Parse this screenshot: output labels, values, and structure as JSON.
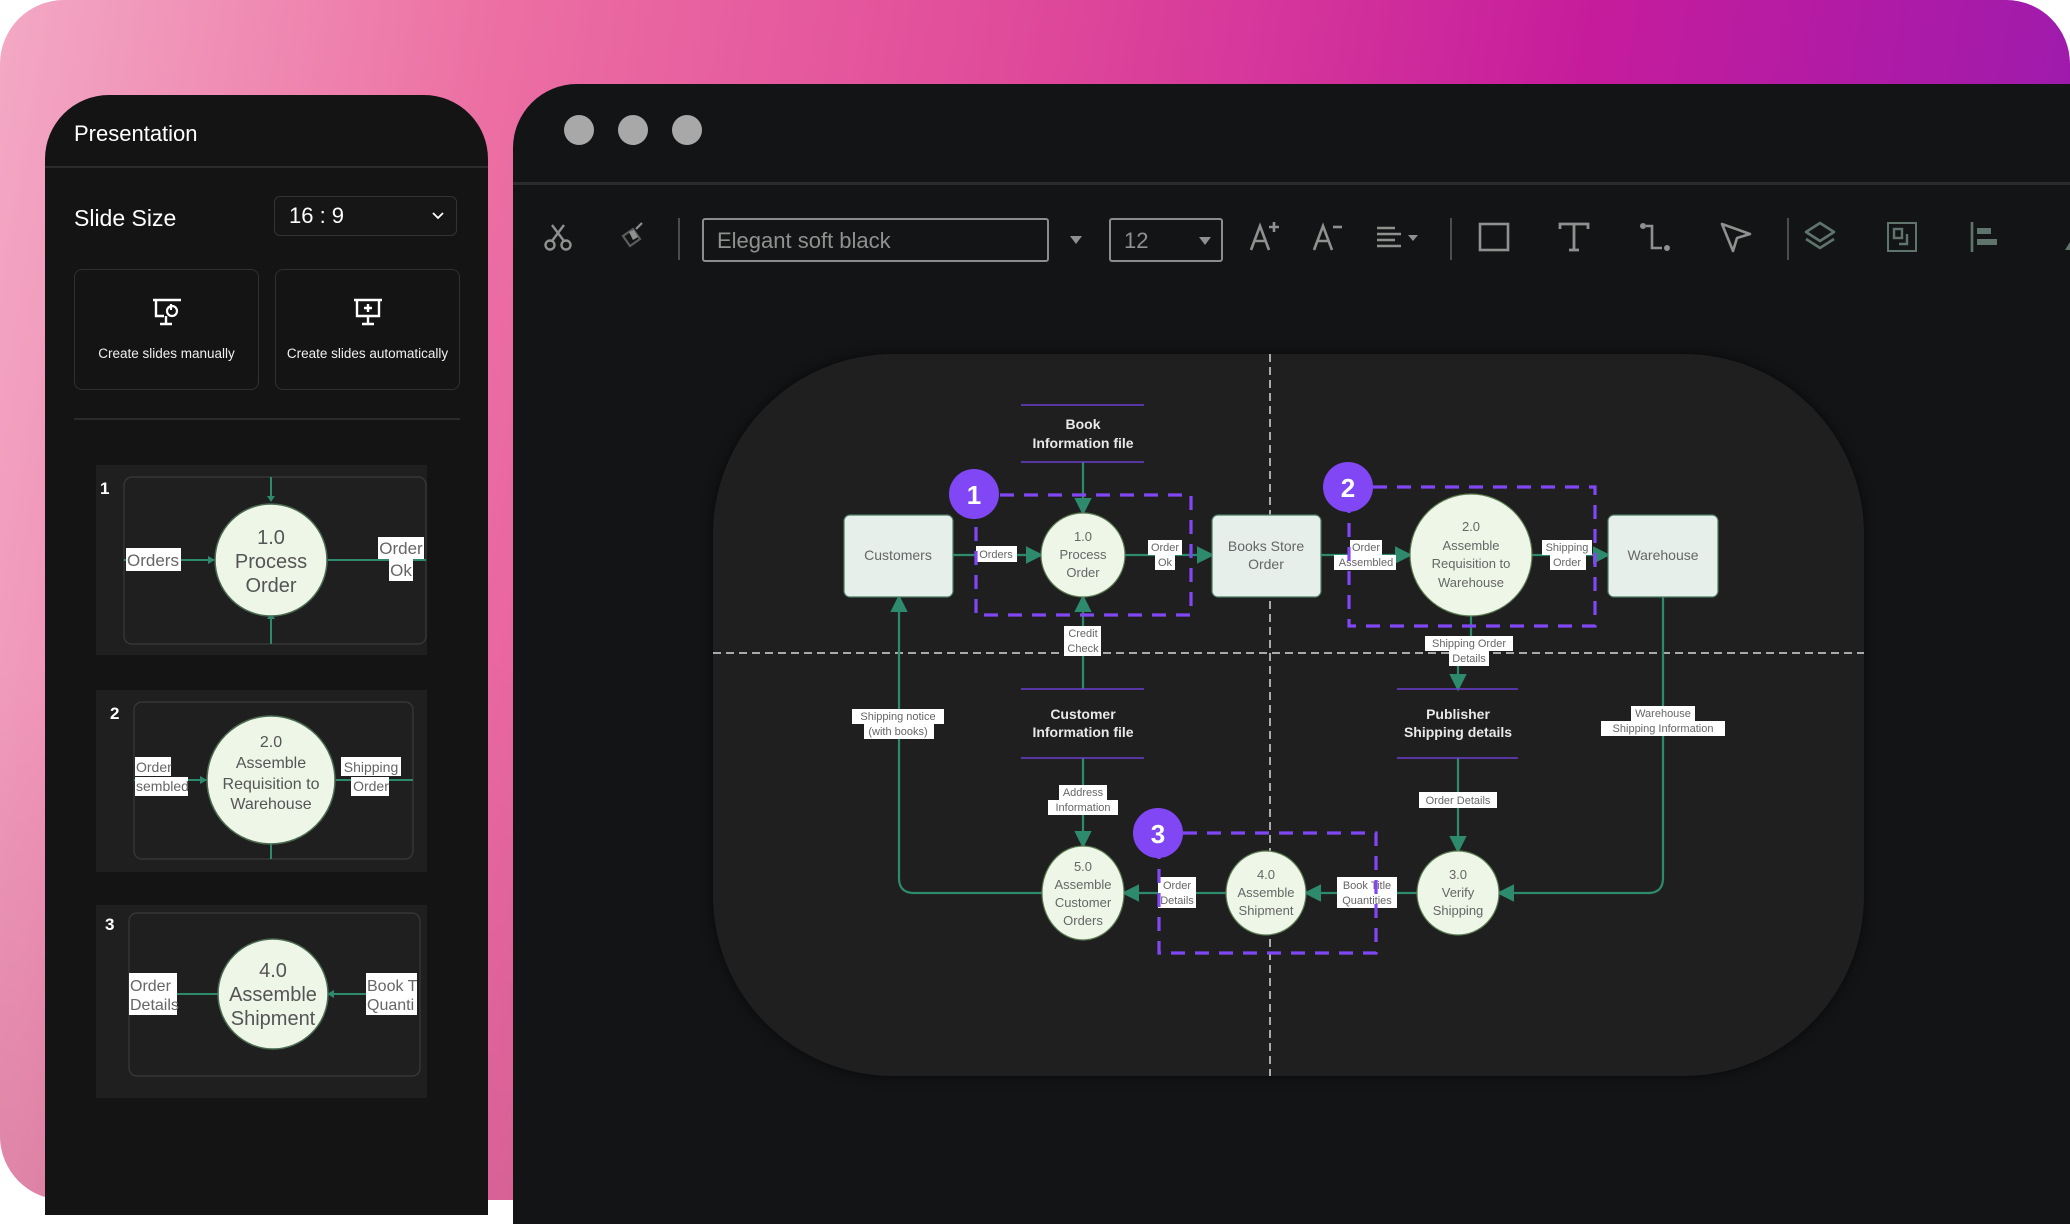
{
  "panel": {
    "title": "Presentation",
    "slide_size_label": "Slide Size",
    "slide_size_value": "16 : 9",
    "create_manual_label": "Create slides manually",
    "create_auto_label": "Create slides automatically",
    "thumbnails": [
      {
        "number": "1",
        "process_id": "1.0",
        "process_lines": [
          "Process",
          "Order"
        ],
        "left_label": [
          "Orders"
        ],
        "right_label": [
          "Order",
          "Ok"
        ]
      },
      {
        "number": "2",
        "process_id": "2.0",
        "process_lines": [
          "Assemble",
          "Requisition to",
          "Warehouse"
        ],
        "left_label": [
          "Order",
          "sembled"
        ],
        "right_label": [
          "Shipping",
          "Order"
        ]
      },
      {
        "number": "3",
        "process_id": "4.0",
        "process_lines": [
          "Assemble",
          "Shipment"
        ],
        "left_label": [
          "Order",
          "Details"
        ],
        "right_label": [
          "Book T",
          "Quanti"
        ]
      }
    ]
  },
  "window": {
    "traffic_lights": [
      "close",
      "minimize",
      "maximize"
    ],
    "toolbar": {
      "cut_icon": "scissors-icon",
      "format_painter_icon": "paint-brush-icon",
      "font_value": "Elegant soft black",
      "font_size_value": "12",
      "icons": [
        "increase-font-icon",
        "decrease-font-icon",
        "align-icon",
        "rectangle-icon",
        "text-icon",
        "connector-icon",
        "pointer-icon",
        "layers-icon",
        "group-icon",
        "align-left-icon",
        "triangle-icon"
      ]
    }
  },
  "diagram": {
    "colors": {
      "entity_fill": "#e6efe9",
      "process_fill": "#eef6e8",
      "flow_line": "#2e8a6c",
      "highlight": "#8147f5",
      "guide_line": "#d8d8d8",
      "store_line": "#6a3fd0"
    },
    "entities": [
      {
        "id": "customers",
        "lines": [
          "Customers"
        ]
      },
      {
        "id": "books-store-order",
        "lines": [
          "Books Store",
          "Order"
        ]
      },
      {
        "id": "warehouse",
        "lines": [
          "Warehouse"
        ]
      }
    ],
    "processes": [
      {
        "id": "p1",
        "lines": [
          "1.0",
          "Process",
          "Order"
        ]
      },
      {
        "id": "p2",
        "lines": [
          "2.0",
          "Assemble",
          "Requisition to",
          "Warehouse"
        ]
      },
      {
        "id": "p5",
        "lines": [
          "5.0",
          "Assemble",
          "Customer",
          "Orders"
        ]
      },
      {
        "id": "p4",
        "lines": [
          "4.0",
          "Assemble",
          "Shipment"
        ]
      },
      {
        "id": "p3",
        "lines": [
          "3.0",
          "Verify",
          "Shipping"
        ]
      }
    ],
    "data_stores": [
      {
        "id": "book-info",
        "lines": [
          "Book",
          "Information file"
        ]
      },
      {
        "id": "customer-info",
        "lines": [
          "Customer",
          "Information file"
        ]
      },
      {
        "id": "publisher-shipping",
        "lines": [
          "Publisher",
          "Shipping details"
        ]
      }
    ],
    "flow_labels": [
      {
        "id": "orders",
        "lines": [
          "Orders"
        ]
      },
      {
        "id": "order-ok",
        "lines": [
          "Order",
          "Ok"
        ]
      },
      {
        "id": "credit-check",
        "lines": [
          "Credit",
          "Check"
        ]
      },
      {
        "id": "order-assembled",
        "lines": [
          "Order",
          "Assembled"
        ]
      },
      {
        "id": "shipping-order",
        "lines": [
          "Shipping",
          "Order"
        ]
      },
      {
        "id": "shipping-order-details",
        "lines": [
          "Shipping Order",
          "Details"
        ]
      },
      {
        "id": "shipping-notice",
        "lines": [
          "Shipping notice",
          "(with books)"
        ]
      },
      {
        "id": "address-info",
        "lines": [
          "Address",
          "Information"
        ]
      },
      {
        "id": "warehouse-shipping-info",
        "lines": [
          "Warehouse",
          "Shipping Information"
        ]
      },
      {
        "id": "order-details-top",
        "lines": [
          "Order Details"
        ]
      },
      {
        "id": "order-details-bottom",
        "lines": [
          "Order",
          "Details"
        ]
      },
      {
        "id": "book-title-quantities",
        "lines": [
          "Book Title",
          "Quantities"
        ]
      }
    ],
    "badges": [
      "1",
      "2",
      "3"
    ]
  }
}
